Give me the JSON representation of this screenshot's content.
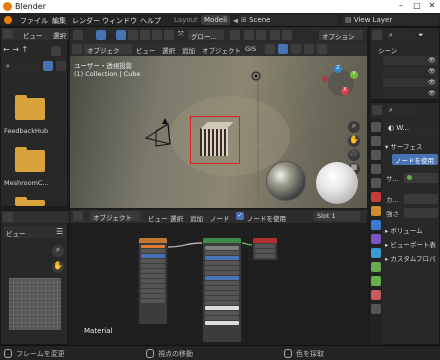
{
  "window": {
    "title": "Blender"
  },
  "menu": {
    "items": [
      "ファイル",
      "編集",
      "レンダー",
      "ウィンドウ",
      "ヘルプ"
    ],
    "workspaces": [
      "Layout",
      "Modeli"
    ],
    "scene": "Scene",
    "view_layer": "View Layer"
  },
  "file_browser": {
    "header_items": [
      "ビュー",
      "選択"
    ],
    "folders": [
      "FeedbackHub",
      "MeshroomC..."
    ]
  },
  "image_editor": {
    "view_label": "ビュー"
  },
  "viewport": {
    "mode": "オブジェクト...",
    "menus": [
      "ビュー",
      "選択",
      "追加",
      "オブジェクト",
      "GIS"
    ],
    "orientation": "グロー...",
    "options": "オプション",
    "info_line1": "ユーザー・透視投影",
    "info_line2": "(1) Collection | Cube",
    "gizmo": {
      "x": "X",
      "y": "Y",
      "z": "Z"
    }
  },
  "node_editor": {
    "mode": "オブジェクト",
    "menus": [
      "ビュー",
      "選択",
      "追加",
      "ノード"
    ],
    "use_nodes_label": "ノードを使用",
    "slot": "Slot 1",
    "material_name": "Material"
  },
  "outliner": {
    "scene_label": "シーン"
  },
  "properties": {
    "object_short": "W...",
    "surface_label": "サーフェス",
    "use_nodes_button": "ノードを使用",
    "surface_short": "サ...",
    "color_short": "カ...",
    "strength_label": "強さ",
    "sections": [
      "ボリューム",
      "ビューポート表",
      "カスタムプロパ"
    ]
  },
  "status_bar": {
    "items": [
      "フレームを変更",
      "視点の移動",
      "色を採取"
    ]
  },
  "colors": {
    "accent": "#4772b3",
    "folder": "#d9a23a",
    "logo": "#e87d0d",
    "select_box": "#e02020"
  }
}
